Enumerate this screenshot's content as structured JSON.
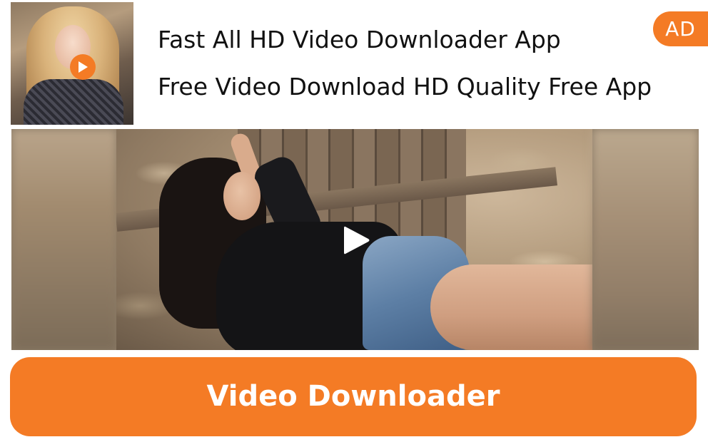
{
  "ad": {
    "headline": "Fast All HD Video Downloader App",
    "subline": "Free Video Download HD Quality Free App",
    "badge": "AD",
    "cta_label": "Video Downloader",
    "icons": {
      "app_icon": "app-thumbnail-icon",
      "app_play": "play-icon",
      "media_play": "play-icon"
    },
    "colors": {
      "accent": "#f47b25",
      "text": "#111111",
      "background": "#ffffff"
    }
  }
}
